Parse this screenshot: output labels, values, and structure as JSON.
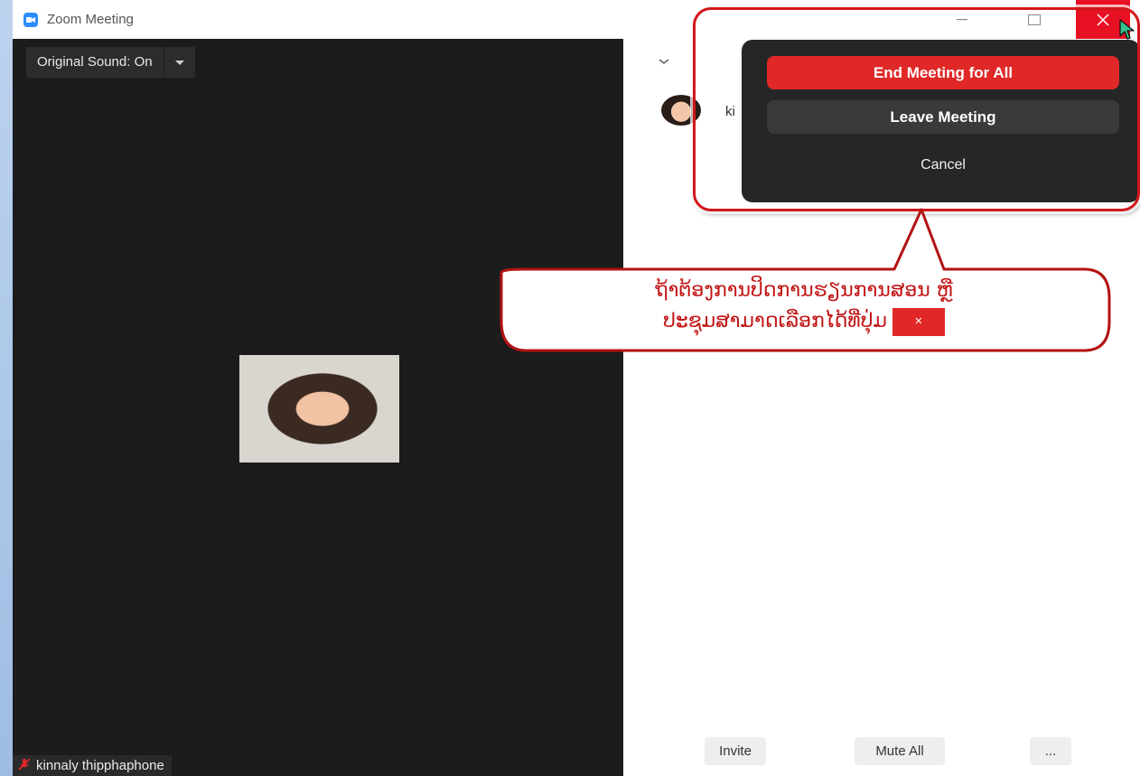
{
  "window": {
    "title": "Zoom Meeting"
  },
  "video": {
    "sound_button": "Original Sound: On",
    "name_tag": "kinnaly thipphaphone"
  },
  "panel": {
    "participant_name_partial": "ki",
    "footer": {
      "invite": "Invite",
      "mute_all": "Mute All",
      "more": "..."
    }
  },
  "popup": {
    "end_label": "End Meeting for All",
    "leave_label": "Leave Meeting",
    "cancel_label": "Cancel"
  },
  "annotation": {
    "line1": "ຖ້າຕ້ອງການປິດການຮຽນການສອນ ຫຼື",
    "line2": "ປະຊຸມສາມາດເລືອກໄດ້ທີ່ປຸ່ມ",
    "close_glyph": "×"
  },
  "colors": {
    "accent_red": "#e02828",
    "zoom_blue": "#2d8cff",
    "dark_bg": "#1c1c1c"
  },
  "icons": {
    "app": "zoom-logo-icon",
    "minimize": "minimize-icon",
    "maximize": "maximize-icon",
    "close": "close-icon",
    "mic": "mic-muted-icon",
    "chevron": "chevron-down-icon",
    "cursor": "mouse-cursor-icon"
  }
}
